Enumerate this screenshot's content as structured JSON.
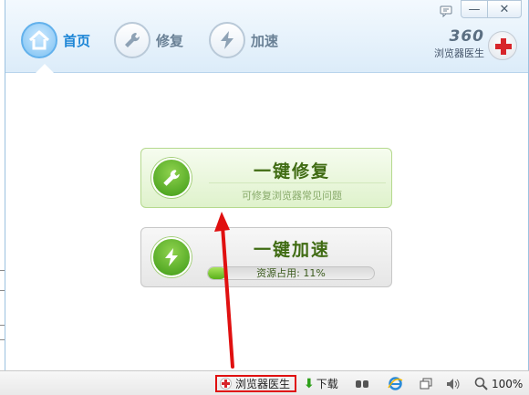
{
  "nav": {
    "items": [
      {
        "label": "首页",
        "icon": "home-icon",
        "active": true
      },
      {
        "label": "修复",
        "icon": "wrench-icon",
        "active": false
      },
      {
        "label": "加速",
        "icon": "lightning-icon",
        "active": false
      }
    ]
  },
  "brand": {
    "number": "360",
    "name": "浏览器医生",
    "icon": "red-cross-icon"
  },
  "window_controls": {
    "feedback_icon": "feedback-icon",
    "minimize": "—",
    "close": "✕"
  },
  "repair_card": {
    "title": "一键修复",
    "subtitle": "可修复浏览器常见问题",
    "icon": "wrench-icon"
  },
  "speed_card": {
    "title": "一键加速",
    "resource_label": "资源占用: 11%",
    "resource_percent": 11,
    "icon": "lightning-icon"
  },
  "statusbar": {
    "doctor_label": "浏览器医生",
    "download_label": "下载",
    "zoom": "100%"
  },
  "colors": {
    "accent_blue": "#1e86d6",
    "green": "#3e9a16",
    "annotation_red": "#e01010"
  }
}
